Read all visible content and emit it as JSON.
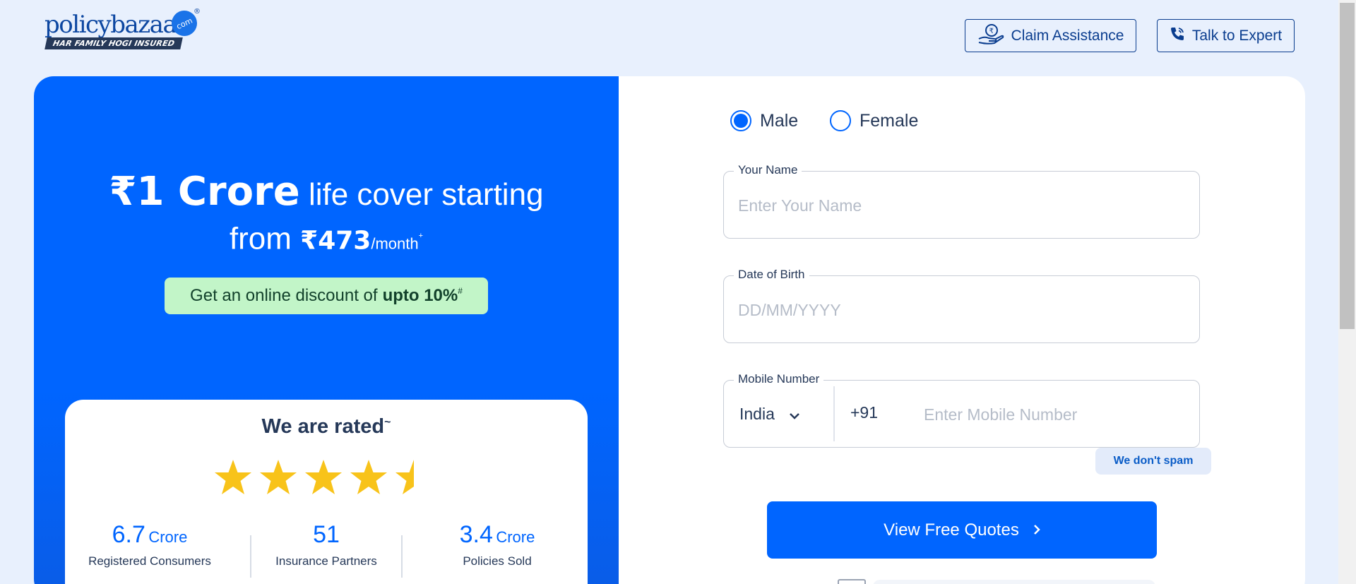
{
  "header": {
    "logo_word": "policybazaar",
    "logo_com": "com",
    "logo_reg": "®",
    "logo_tagline": "HAR FAMILY HOGI INSURED",
    "claim_button": "Claim Assistance",
    "expert_button": "Talk to Expert"
  },
  "hero": {
    "amount": "₹1 Crore",
    "line1_rest": "life cover starting",
    "from": "from",
    "price": "₹473",
    "per_month": "/month",
    "price_mark": "+",
    "discount_text": "Get an online discount of",
    "discount_bold": "upto 10%",
    "discount_mark": "#"
  },
  "rating": {
    "title": "We are rated",
    "title_mark": "~",
    "stars_value": 4.5,
    "stars_max": 5,
    "star_color": "#f8c31a",
    "stats": [
      {
        "num": "6.7",
        "unit": "Crore",
        "label": "Registered Consumers"
      },
      {
        "num": "51",
        "unit": "",
        "label": "Insurance Partners"
      },
      {
        "num": "3.4",
        "unit": "Crore",
        "label": "Policies Sold"
      }
    ]
  },
  "form": {
    "gender": {
      "male": "Male",
      "female": "Female",
      "selected": "Male"
    },
    "name": {
      "label": "Your Name",
      "placeholder": "Enter Your Name",
      "value": ""
    },
    "dob": {
      "label": "Date of Birth",
      "placeholder": "DD/MM/YYYY",
      "value": ""
    },
    "mobile": {
      "label": "Mobile Number",
      "country": "India",
      "prefix": "+91",
      "placeholder": "Enter Mobile Number",
      "value": ""
    },
    "no_spam": "We don't spam",
    "cta": "View Free Quotes"
  },
  "colors": {
    "primary": "#0065ff",
    "page_bg": "#e8f0fd",
    "discount_bg": "#c2f5c8",
    "text_dark": "#253858"
  }
}
